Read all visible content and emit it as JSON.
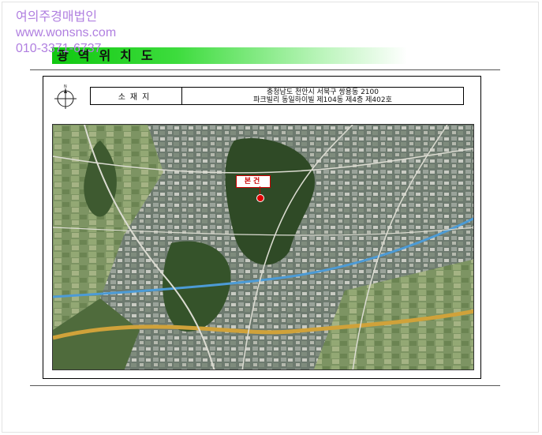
{
  "watermark": {
    "company": "여의주경매법인",
    "website": "www.wonsns.com",
    "phone": "010-3371-6737"
  },
  "document": {
    "title": "광역위치도",
    "info": {
      "label": "소재지",
      "address_line1": "충청남도 천안시 서북구 쌍용동 2100",
      "address_line2": "파크빌리 동일하이빌 제104동 제4층 제402호"
    },
    "marker_label": "본건"
  },
  "colors": {
    "watermark": "#b07fe0",
    "title_bar": "#10c810",
    "marker": "#e00000"
  },
  "icons": [
    "compass-icon",
    "location-pin-icon"
  ]
}
